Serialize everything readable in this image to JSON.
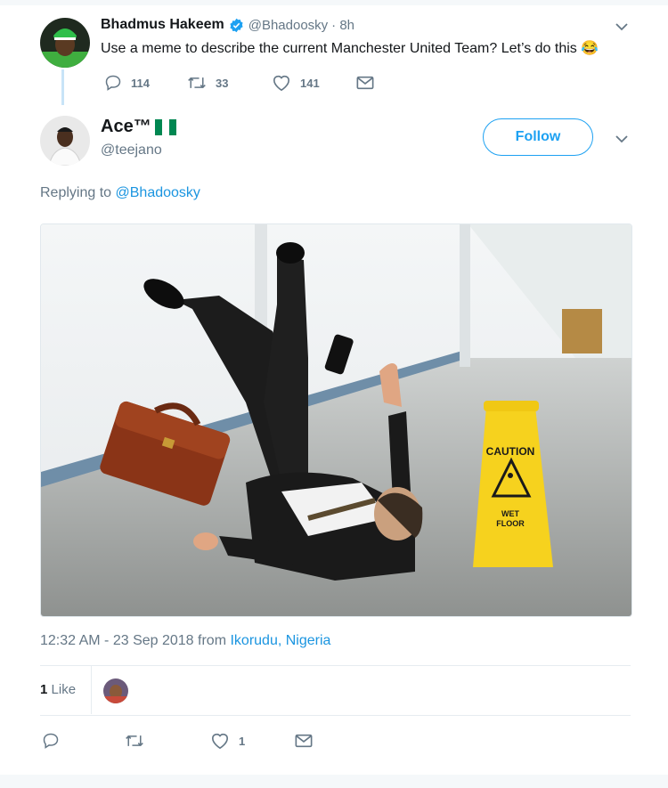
{
  "original_tweet": {
    "author_name": "Bhadmus Hakeem",
    "handle": "@Bhadoosky",
    "time": "· 8h",
    "text": "Use a meme to describe the current Manchester United Team? Let’s do this",
    "emoji": "😂",
    "replies": "114",
    "retweets": "33",
    "likes": "141"
  },
  "reply_tweet": {
    "author_name": "Ace™",
    "handle": "@teejano",
    "follow_label": "Follow",
    "replying_prefix": "Replying to",
    "replying_handle": "@Bhadoosky",
    "image_sign_line1": "CAUTION",
    "image_sign_line2": "WET",
    "image_sign_line3": "FLOOR",
    "timestamp": "12:32 AM - 23 Sep 2018 from",
    "location": "Ikorudu, Nigeria",
    "like_count": "1",
    "like_label": "Like",
    "action_like_count": "1"
  },
  "colors": {
    "accent": "#1da1f2",
    "link": "#1b95e0",
    "muted": "#657786",
    "verified": "#1da1f2",
    "nigeria_green": "#008751"
  },
  "icons": [
    "verified-icon",
    "chevron-down-icon",
    "reply-icon",
    "retweet-icon",
    "heart-icon",
    "message-icon",
    "nigeria-flag-icon"
  ]
}
